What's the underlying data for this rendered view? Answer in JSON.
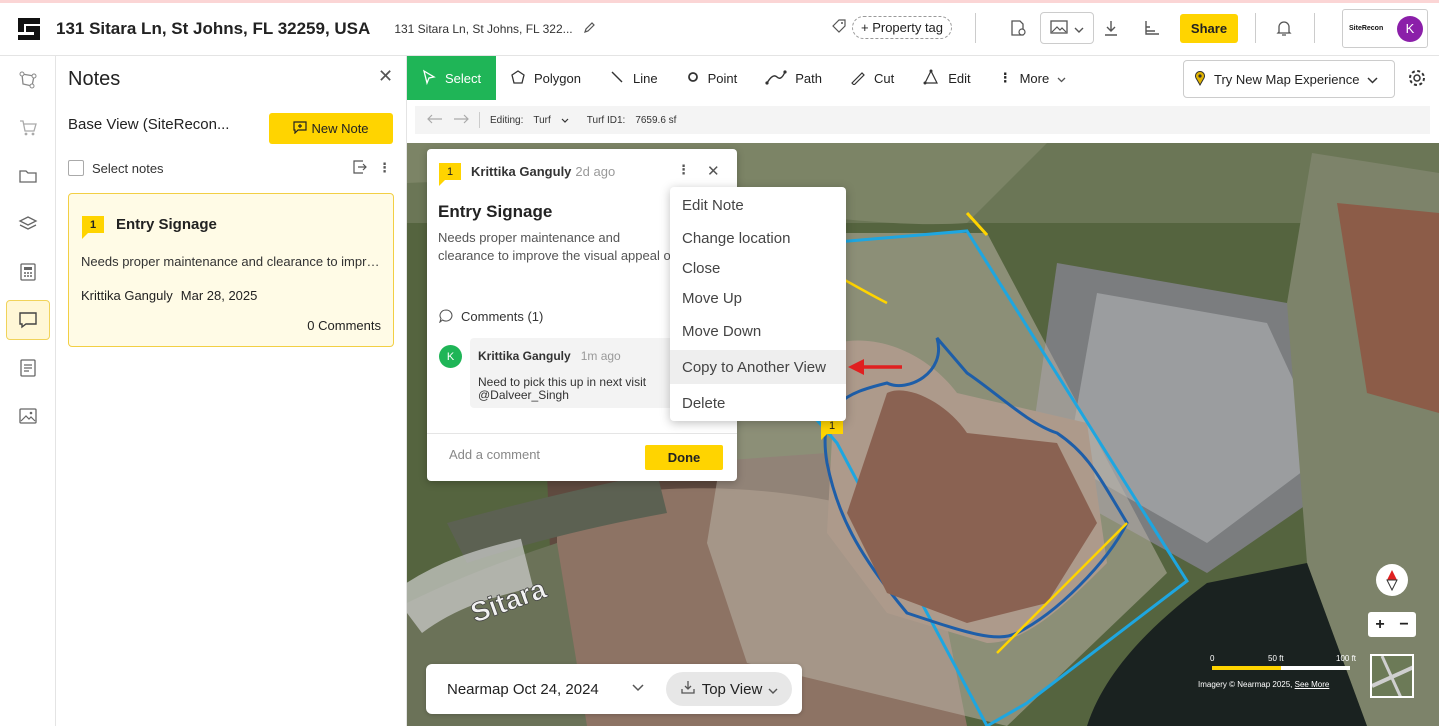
{
  "header": {
    "title": "131 Sitara Ln, St Johns, FL 32259, USA",
    "subtitle": "131 Sitara Ln, St Johns, FL 322...",
    "property_tag": "+ Property tag",
    "share_label": "Share",
    "org_logo": "SiteRecon",
    "avatar_initial": "K"
  },
  "notes_panel": {
    "title": "Notes",
    "base_view": "Base View (SiteRecon...",
    "new_note_label": "New Note",
    "select_notes_label": "Select notes",
    "card": {
      "number": "1",
      "title": "Entry Signage",
      "body": "Needs proper maintenance and clearance to improve the visual appeal",
      "author": "Krittika Ganguly",
      "date": "Mar 28, 2025",
      "comments": "0 Comments"
    }
  },
  "toolbar": {
    "tools": [
      "Select",
      "Polygon",
      "Line",
      "Point",
      "Path",
      "Cut",
      "Edit",
      "More"
    ],
    "try_map": "Try New Map Experience"
  },
  "subbar": {
    "editing_label": "Editing:",
    "editing_value": "Turf",
    "turf_label": "Turf ID1:",
    "turf_value": "7659.6 sf"
  },
  "popup": {
    "number": "1",
    "author": "Krittika Ganguly",
    "ago": "2d ago",
    "title": "Entry Signage",
    "body": "Needs proper maintenance and clearance to improve the visual appeal of the entry",
    "comments_label": "Comments (1)",
    "comment": {
      "avatar": "K",
      "author": "Krittika Ganguly",
      "ago": "1m ago",
      "text_line1": "Need to pick this up in next visit",
      "text_line2": "@Dalveer_Singh"
    },
    "input_placeholder": "Add a comment",
    "done_label": "Done"
  },
  "context_menu": {
    "items": [
      "Edit Note",
      "Change location",
      "Close",
      "Move Up",
      "Move Down",
      "Copy to Another View",
      "Delete"
    ],
    "highlighted_index": 5
  },
  "map": {
    "street_label": "Sitara",
    "pin_number": "1",
    "date_label": "Nearmap Oct 24, 2024",
    "view_label": "Top View",
    "scale_labels": [
      "0",
      "50 ft",
      "100 ft"
    ],
    "imagery_credit": "Imagery © Nearmap 2025,",
    "see_more": "See More",
    "zoom_in": "+",
    "zoom_out": "−"
  },
  "colors": {
    "accent_yellow": "#ffd400",
    "select_green": "#1fb557",
    "boundary_blue": "#1ea6e0",
    "arrow_red": "#e02020"
  }
}
